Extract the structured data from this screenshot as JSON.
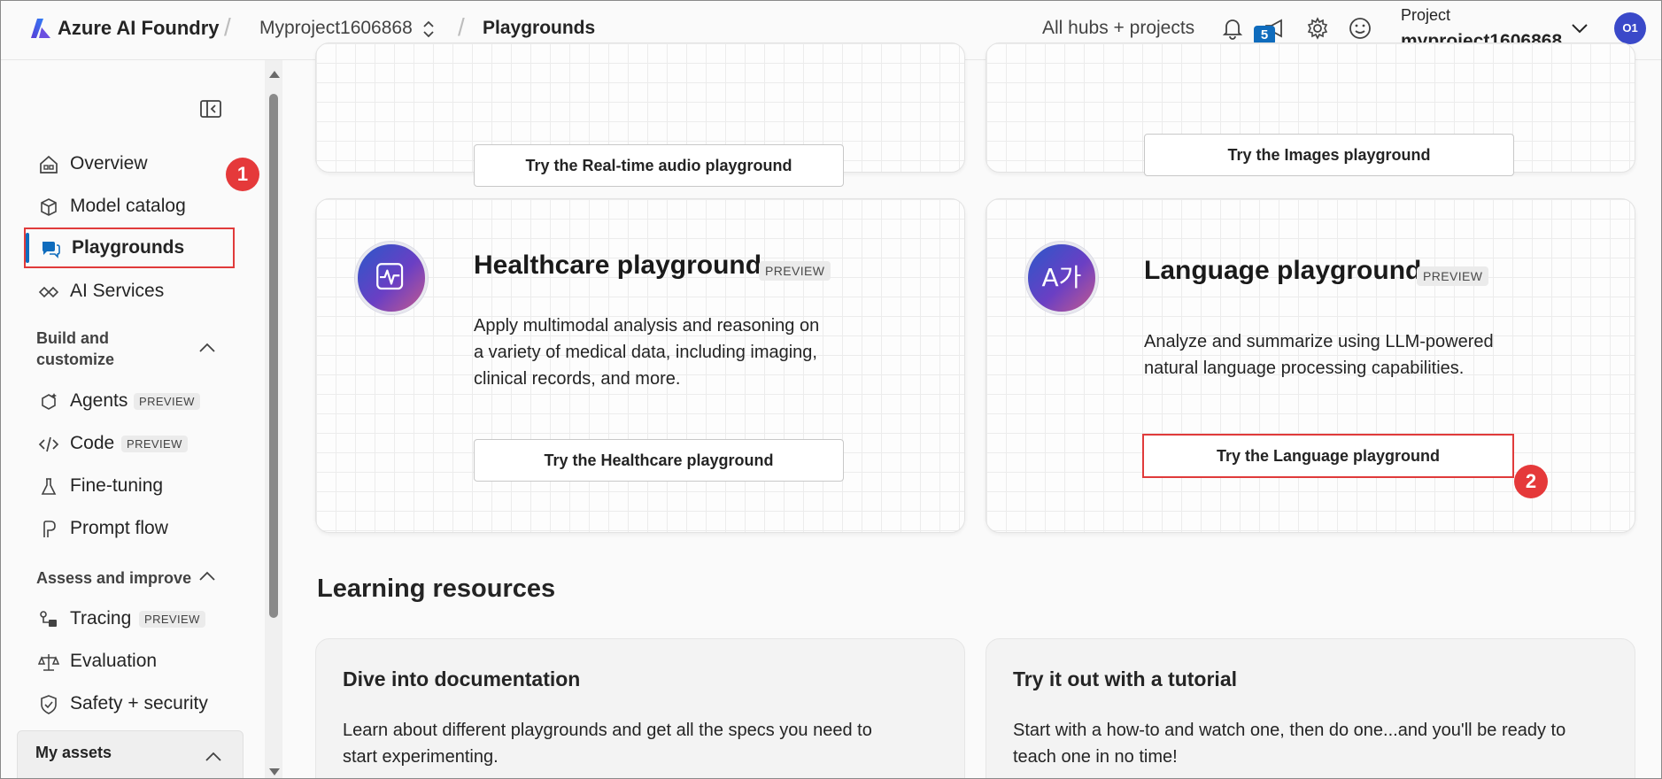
{
  "topbar": {
    "brand": "Azure AI Foundry",
    "project_crumb": "Myproject1606868",
    "page_crumb": "Playgrounds",
    "hubs_link": "All hubs + projects",
    "notification_count": "5",
    "project_label": "Project",
    "project_name": "myproject1606868",
    "avatar_initials": "O1"
  },
  "sidebar": {
    "items": [
      {
        "label": "Overview",
        "icon": "home-icon"
      },
      {
        "label": "Model catalog",
        "icon": "cube-icon"
      },
      {
        "label": "Playgrounds",
        "icon": "chat-bubbles-icon",
        "active": true
      },
      {
        "label": "AI Services",
        "icon": "diamond-link-icon"
      }
    ],
    "build_section": "Build and customize",
    "build_items": [
      {
        "label": "Agents",
        "badge": "PREVIEW"
      },
      {
        "label": "Code",
        "badge": "PREVIEW"
      },
      {
        "label": "Fine-tuning"
      },
      {
        "label": "Prompt flow"
      }
    ],
    "assess_section": "Assess and improve",
    "assess_items": [
      {
        "label": "Tracing",
        "badge": "PREVIEW"
      },
      {
        "label": "Evaluation"
      },
      {
        "label": "Safety + security"
      }
    ],
    "assets_section": "My assets"
  },
  "annotations": {
    "step1": "1",
    "step2": "2"
  },
  "main": {
    "top_left_button": "Try the Real-time audio playground",
    "top_right_button": "Try the Images playground",
    "healthcare": {
      "title": "Healthcare playground",
      "badge": "PREVIEW",
      "desc_line1": "Apply multimodal analysis and reasoning on",
      "desc_line2": "a variety of medical data, including imaging,",
      "desc_line3": "clinical records, and more.",
      "button": "Try the Healthcare playground"
    },
    "language": {
      "title": "Language playground",
      "badge": "PREVIEW",
      "desc_line1": "Analyze and summarize using LLM-powered",
      "desc_line2": "natural language processing capabilities.",
      "button": "Try the Language playground",
      "icon_glyph": "A가"
    },
    "learning_title": "Learning resources",
    "docs": {
      "title": "Dive into documentation",
      "desc": "Learn about different playgrounds and get all the specs you need to start experimenting."
    },
    "tutorial": {
      "title": "Try it out with a tutorial",
      "desc": "Start with a how-to and watch one, then do one...and you'll be ready to teach one in no time!"
    }
  }
}
